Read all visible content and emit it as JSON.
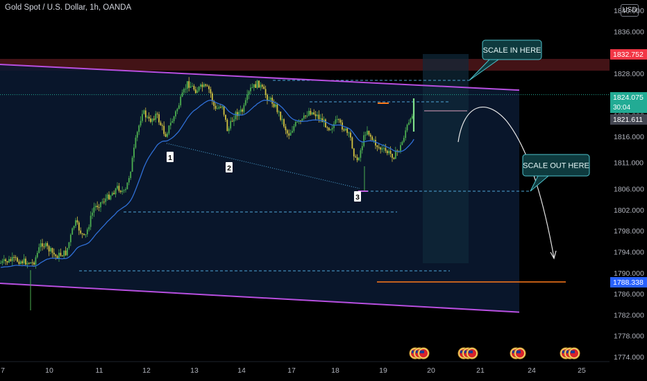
{
  "header": {
    "title": "Gold Spot / U.S. Dollar, 1h, OANDA",
    "currency_button": "USD"
  },
  "chart_data": {
    "type": "candlestick",
    "y_ticks": [
      1840,
      1836,
      1832,
      1828,
      1824,
      1820,
      1816,
      1811,
      1806,
      1802,
      1798,
      1794,
      1790,
      1786,
      1782,
      1778,
      1774
    ],
    "y_tick_labels": [
      "1840.000",
      "1836.000",
      "1832.000",
      "1828.000",
      "1824.000",
      "1820.000",
      "1816.000",
      "1811.000",
      "1806.000",
      "1802.000",
      "1798.000",
      "1794.000",
      "1790.000",
      "1786.000",
      "1782.000",
      "1778.000",
      "1774.000"
    ],
    "x_ticks": [
      "7",
      "10",
      "11",
      "12",
      "13",
      "14",
      "17",
      "18",
      "19",
      "20",
      "21",
      "24",
      "25"
    ],
    "price_badges": [
      {
        "label": "1832.752",
        "color": "#f23645"
      },
      {
        "label": "1824.075",
        "sub": "30:04",
        "color": "#22ab94"
      },
      {
        "label": "1821.611",
        "color": "#434651"
      },
      {
        "label": "1788.338",
        "color": "#2962ff"
      }
    ],
    "annotations": {
      "scale_in": "SCALE IN HERE",
      "scale_out": "SCALE OUT HERE",
      "points": [
        "1",
        "2",
        "3"
      ]
    },
    "levels": {
      "scale_in_level": 1828.3,
      "resistance_box": [
        1831.0,
        1834.2
      ],
      "current_price": 1824.075,
      "scale_out_level": 1806.0,
      "support_1": 1801.8,
      "support_2": 1790.3,
      "target": 1788.338
    },
    "channel": {
      "upper": [
        [
          0,
          1829.7
        ],
        [
          748,
          1824.8
        ]
      ],
      "lower": [
        [
          0,
          1788.0
        ],
        [
          748,
          1782.5
        ]
      ]
    },
    "trendline_points": [
      [
        240,
        1814.7
      ],
      [
        518,
        1806.0
      ]
    ],
    "colors": {
      "up": "#4caf50",
      "down": "#d4c440",
      "ema": "#2f6fd6",
      "channel": "#b84fe0",
      "annotation": "#4ec2cc",
      "dashed_level": "#4ea7d9"
    }
  }
}
